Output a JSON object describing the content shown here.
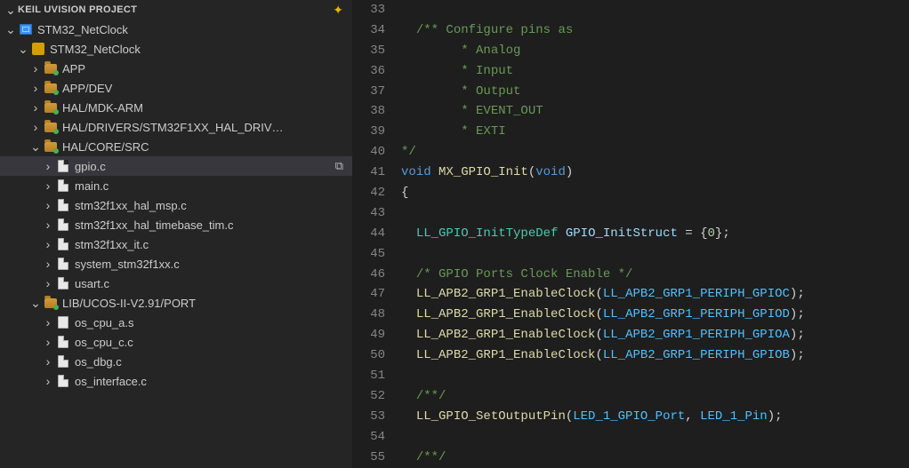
{
  "sidebar": {
    "header": "KEIL UVISION PROJECT",
    "header_action_icon": "diamond-plus-icon",
    "tree": [
      {
        "depth": 0,
        "chev": "down",
        "icon": "proj",
        "label": "STM32_NetClock"
      },
      {
        "depth": 1,
        "chev": "down",
        "icon": "pkg",
        "label": "STM32_NetClock"
      },
      {
        "depth": 2,
        "chev": "right",
        "icon": "folder-green",
        "label": "APP"
      },
      {
        "depth": 2,
        "chev": "right",
        "icon": "folder-green",
        "label": "APP/DEV"
      },
      {
        "depth": 2,
        "chev": "right",
        "icon": "folder-green",
        "label": "HAL/MDK-ARM"
      },
      {
        "depth": 2,
        "chev": "right",
        "icon": "folder-green",
        "label": "HAL/DRIVERS/STM32F1XX_HAL_DRIV…"
      },
      {
        "depth": 2,
        "chev": "down",
        "icon": "folder-green",
        "label": "HAL/CORE/SRC"
      },
      {
        "depth": 3,
        "chev": "right",
        "icon": "file",
        "label": "gpio.c",
        "selected": true,
        "trail_icon": "copy-icon"
      },
      {
        "depth": 3,
        "chev": "right",
        "icon": "file",
        "label": "main.c"
      },
      {
        "depth": 3,
        "chev": "right",
        "icon": "file",
        "label": "stm32f1xx_hal_msp.c"
      },
      {
        "depth": 3,
        "chev": "right",
        "icon": "file",
        "label": "stm32f1xx_hal_timebase_tim.c"
      },
      {
        "depth": 3,
        "chev": "right",
        "icon": "file",
        "label": "stm32f1xx_it.c"
      },
      {
        "depth": 3,
        "chev": "right",
        "icon": "file",
        "label": "system_stm32f1xx.c"
      },
      {
        "depth": 3,
        "chev": "right",
        "icon": "file",
        "label": "usart.c"
      },
      {
        "depth": 2,
        "chev": "down",
        "icon": "folder-green",
        "label": "LIB/UCOS-II-V2.91/PORT"
      },
      {
        "depth": 3,
        "chev": "right",
        "icon": "file-asm",
        "label": "os_cpu_a.s"
      },
      {
        "depth": 3,
        "chev": "right",
        "icon": "file",
        "label": "os_cpu_c.c"
      },
      {
        "depth": 3,
        "chev": "right",
        "icon": "file",
        "label": "os_dbg.c"
      },
      {
        "depth": 3,
        "chev": "right",
        "icon": "file",
        "label": "os_interface.c"
      }
    ]
  },
  "editor": {
    "first_line_number": 33,
    "lines": [
      {
        "tokens": []
      },
      {
        "tokens": [
          [
            "",
            "  "
          ],
          [
            "comment",
            "/** Configure pins as"
          ]
        ]
      },
      {
        "tokens": [
          [
            "",
            "     "
          ],
          [
            "comment",
            "   * Analog"
          ]
        ]
      },
      {
        "tokens": [
          [
            "",
            "     "
          ],
          [
            "comment",
            "   * Input"
          ]
        ]
      },
      {
        "tokens": [
          [
            "",
            "     "
          ],
          [
            "comment",
            "   * Output"
          ]
        ]
      },
      {
        "tokens": [
          [
            "",
            "     "
          ],
          [
            "comment",
            "   * EVENT_OUT"
          ]
        ]
      },
      {
        "tokens": [
          [
            "",
            "     "
          ],
          [
            "comment",
            "   * EXTI"
          ]
        ]
      },
      {
        "tokens": [
          [
            "comment",
            "*/"
          ]
        ]
      },
      {
        "tokens": [
          [
            "key",
            "void"
          ],
          [
            "",
            " "
          ],
          [
            "func",
            "MX_GPIO_Init"
          ],
          [
            "pun",
            "("
          ],
          [
            "key",
            "void"
          ],
          [
            "pun",
            ")"
          ]
        ]
      },
      {
        "tokens": [
          [
            "pun",
            "{"
          ]
        ]
      },
      {
        "tokens": []
      },
      {
        "tokens": [
          [
            "",
            "  "
          ],
          [
            "type",
            "LL_GPIO_InitTypeDef"
          ],
          [
            "",
            " "
          ],
          [
            "var",
            "GPIO_InitStruct"
          ],
          [
            "",
            " "
          ],
          [
            "pun",
            "="
          ],
          [
            "",
            " "
          ],
          [
            "pun",
            "{"
          ],
          [
            "num",
            "0"
          ],
          [
            "pun",
            "}"
          ],
          [
            "pun",
            ";"
          ]
        ]
      },
      {
        "tokens": []
      },
      {
        "tokens": [
          [
            "",
            "  "
          ],
          [
            "comment",
            "/* GPIO Ports Clock Enable */"
          ]
        ]
      },
      {
        "tokens": [
          [
            "",
            "  "
          ],
          [
            "func",
            "LL_APB2_GRP1_EnableClock"
          ],
          [
            "pun",
            "("
          ],
          [
            "const",
            "LL_APB2_GRP1_PERIPH_GPIOC"
          ],
          [
            "pun",
            ")"
          ],
          [
            "pun",
            ";"
          ]
        ]
      },
      {
        "tokens": [
          [
            "",
            "  "
          ],
          [
            "func",
            "LL_APB2_GRP1_EnableClock"
          ],
          [
            "pun",
            "("
          ],
          [
            "const",
            "LL_APB2_GRP1_PERIPH_GPIOD"
          ],
          [
            "pun",
            ")"
          ],
          [
            "pun",
            ";"
          ]
        ]
      },
      {
        "tokens": [
          [
            "",
            "  "
          ],
          [
            "func",
            "LL_APB2_GRP1_EnableClock"
          ],
          [
            "pun",
            "("
          ],
          [
            "const",
            "LL_APB2_GRP1_PERIPH_GPIOA"
          ],
          [
            "pun",
            ")"
          ],
          [
            "pun",
            ";"
          ]
        ]
      },
      {
        "tokens": [
          [
            "",
            "  "
          ],
          [
            "func",
            "LL_APB2_GRP1_EnableClock"
          ],
          [
            "pun",
            "("
          ],
          [
            "const",
            "LL_APB2_GRP1_PERIPH_GPIOB"
          ],
          [
            "pun",
            ")"
          ],
          [
            "pun",
            ";"
          ]
        ]
      },
      {
        "tokens": []
      },
      {
        "tokens": [
          [
            "",
            "  "
          ],
          [
            "comment",
            "/**/"
          ]
        ]
      },
      {
        "tokens": [
          [
            "",
            "  "
          ],
          [
            "func",
            "LL_GPIO_SetOutputPin"
          ],
          [
            "pun",
            "("
          ],
          [
            "const",
            "LED_1_GPIO_Port"
          ],
          [
            "pun",
            ","
          ],
          [
            "",
            " "
          ],
          [
            "const",
            "LED_1_Pin"
          ],
          [
            "pun",
            ")"
          ],
          [
            "pun",
            ";"
          ]
        ]
      },
      {
        "tokens": []
      },
      {
        "tokens": [
          [
            "",
            "  "
          ],
          [
            "comment",
            "/**/"
          ]
        ]
      }
    ]
  }
}
